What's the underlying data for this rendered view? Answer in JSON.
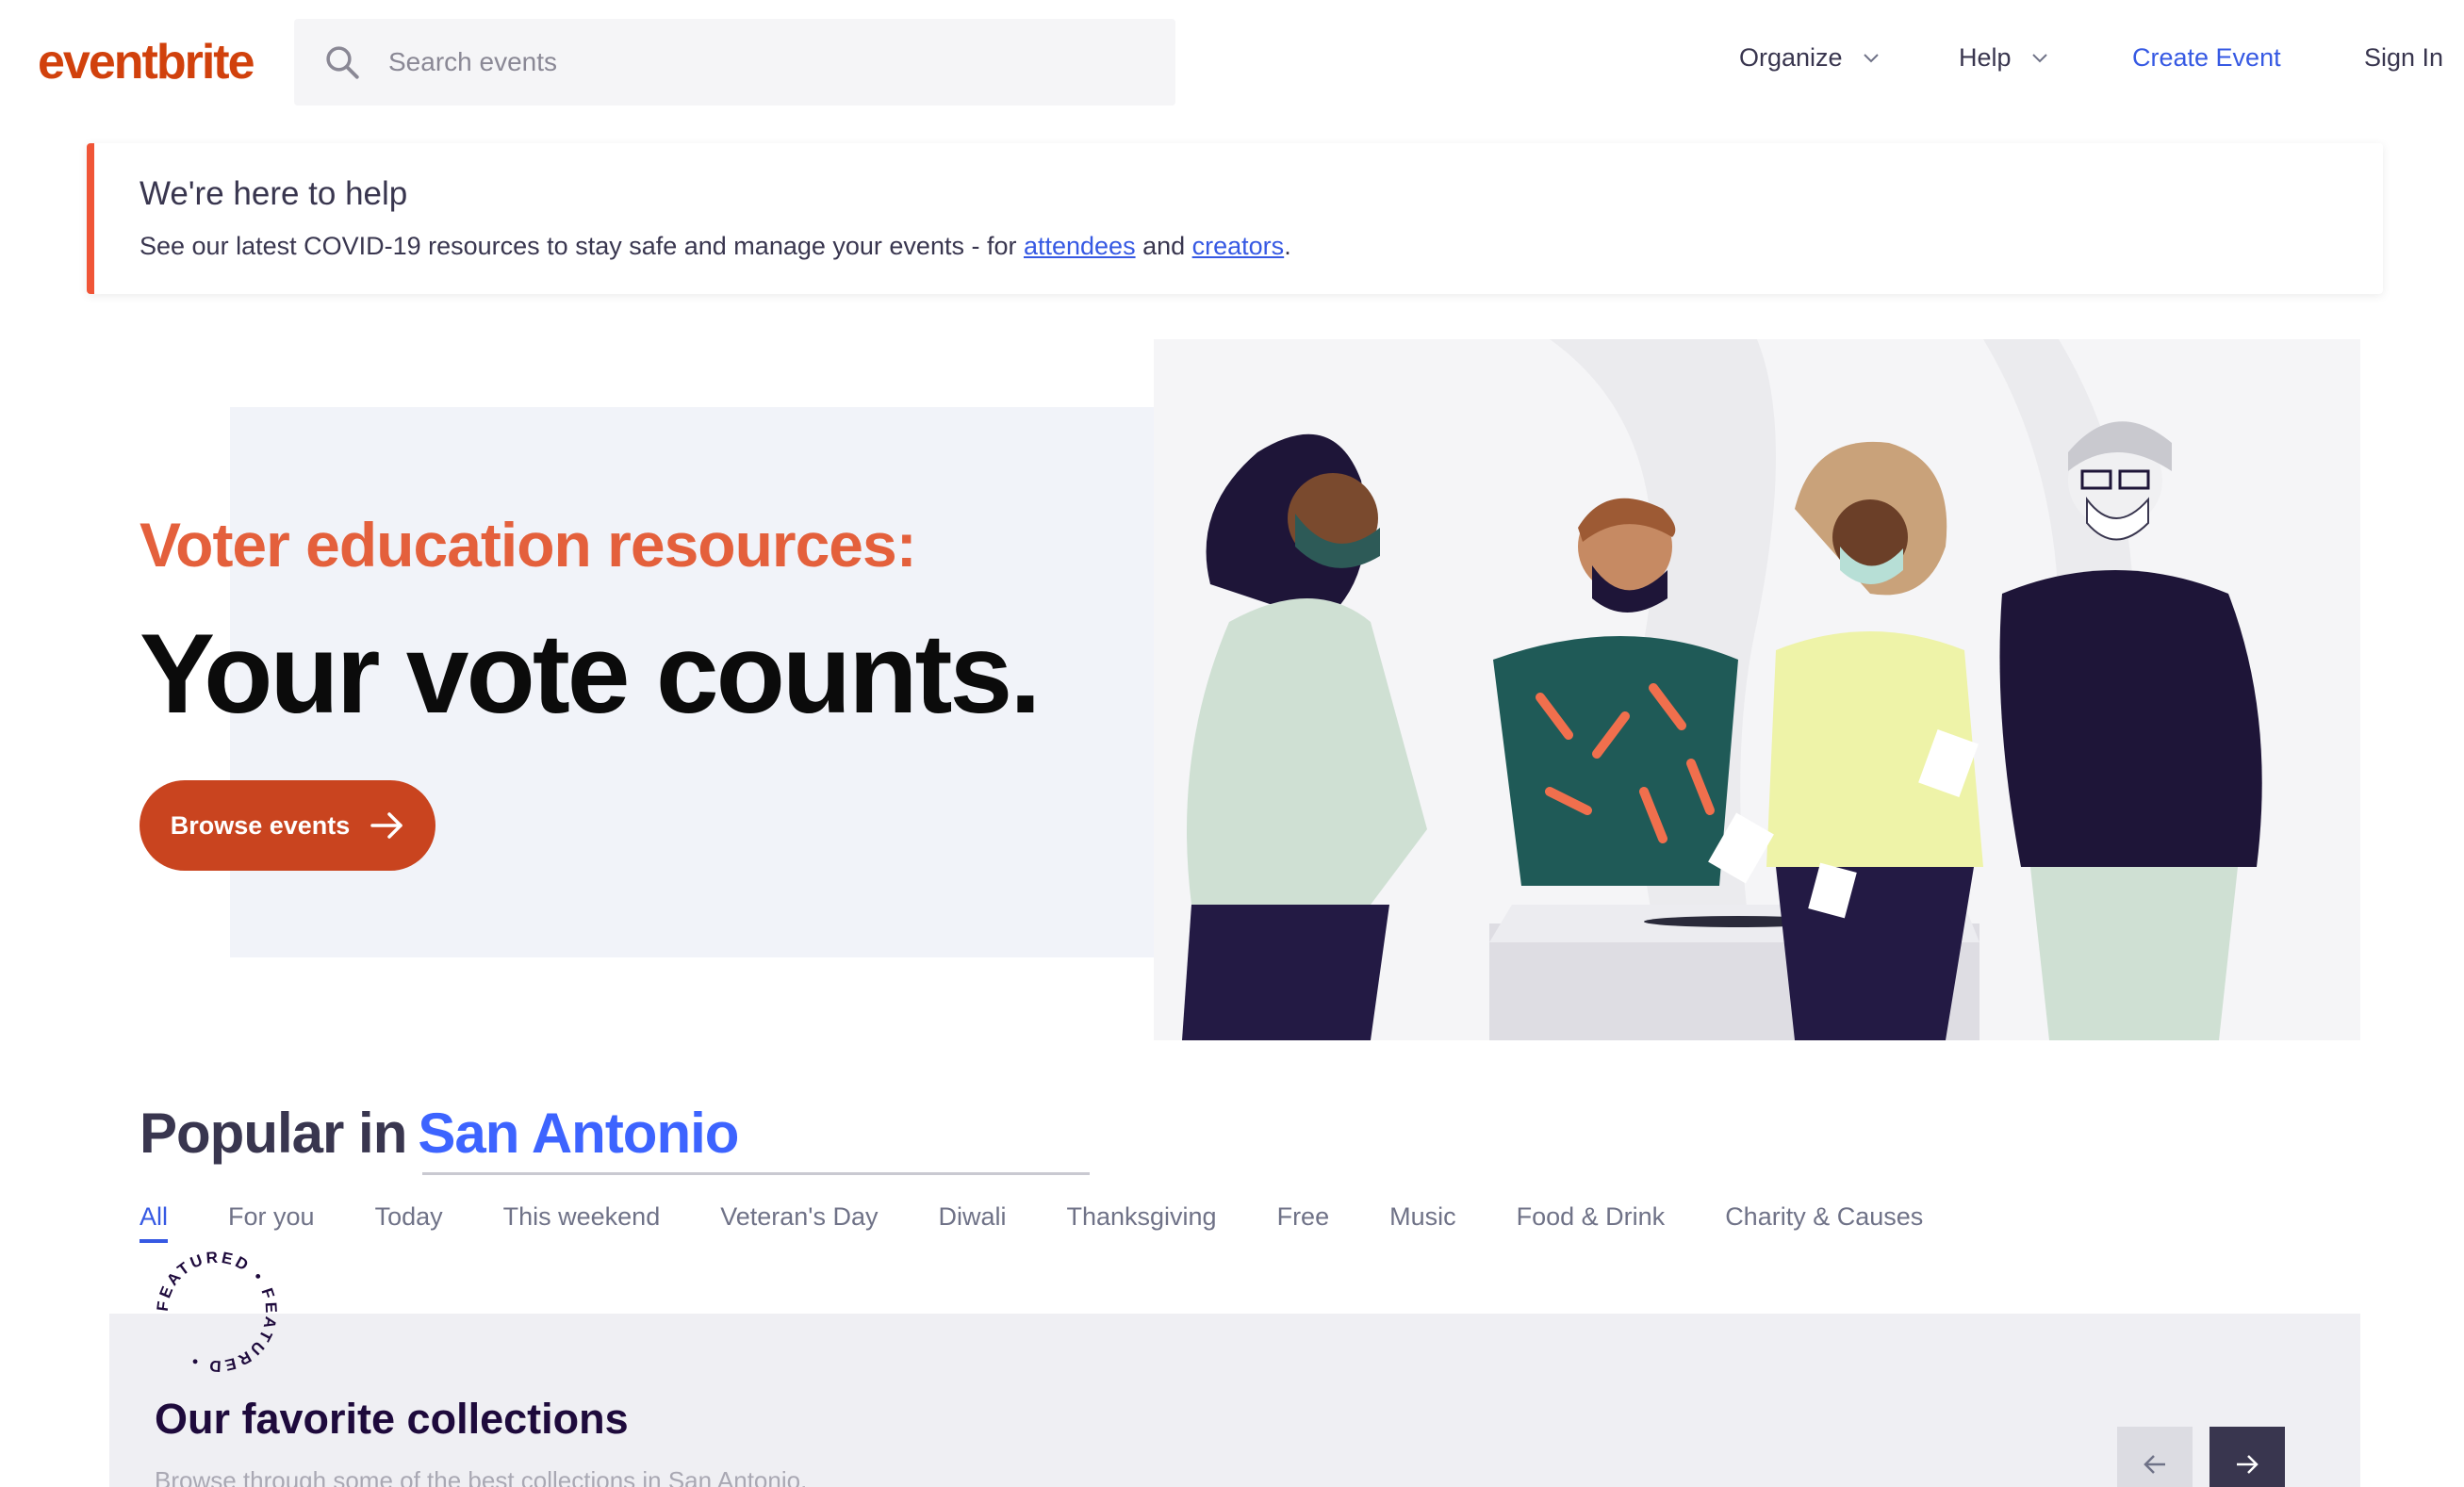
{
  "header": {
    "logo": "eventbrite",
    "search_placeholder": "Search events",
    "nav": {
      "organize": "Organize",
      "help": "Help",
      "create_event": "Create Event",
      "sign_in": "Sign In"
    }
  },
  "alert": {
    "title": "We're here to help",
    "text_before": "See our latest COVID-19 resources to stay safe and manage your events - for ",
    "link_attendees": "attendees",
    "text_middle": " and ",
    "link_creators": "creators",
    "text_after": "."
  },
  "hero": {
    "kicker": "Voter education resources:",
    "title": "Your vote counts.",
    "button": "Browse events"
  },
  "popular": {
    "prefix": "Popular in",
    "city": "San Antonio",
    "tabs": [
      "All",
      "For you",
      "Today",
      "This weekend",
      "Veteran's Day",
      "Diwali",
      "Thanksgiving",
      "Free",
      "Music",
      "Food & Drink",
      "Charity & Causes"
    ]
  },
  "collections": {
    "badge_text": "FEATURED • FEATURED •",
    "title": "Our favorite collections",
    "subtitle": "Browse through some of the best collections in San Antonio."
  },
  "colors": {
    "brand": "#d1410c",
    "link": "#3659e3",
    "accent_orange": "#e4603c"
  }
}
